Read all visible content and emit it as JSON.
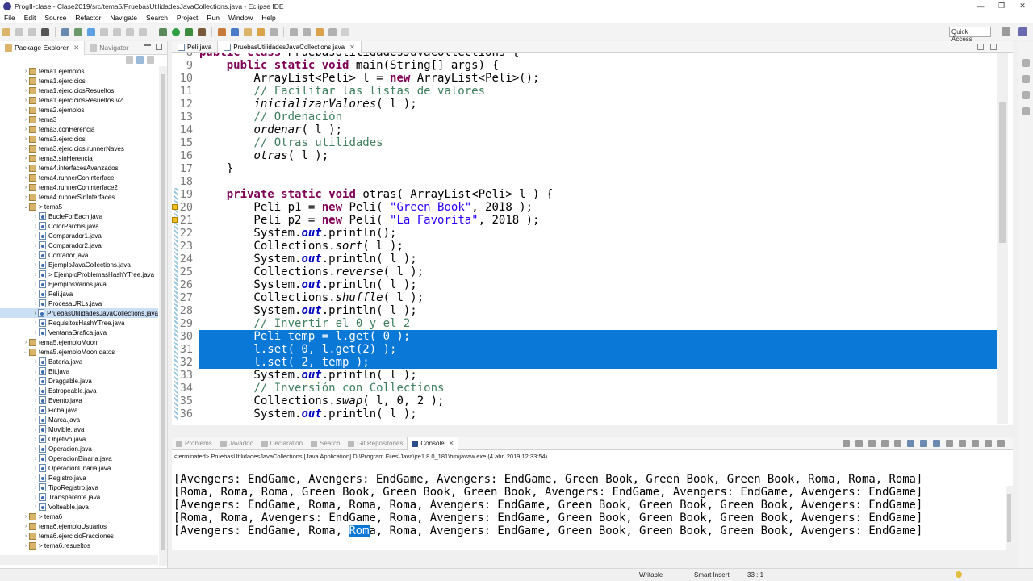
{
  "window": {
    "title": "ProgII-clase - Clase2019/src/tema5/PruebasUtilidadesJavaCollections.java - Eclipse IDE"
  },
  "menu": [
    "File",
    "Edit",
    "Source",
    "Refactor",
    "Navigate",
    "Search",
    "Project",
    "Run",
    "Window",
    "Help"
  ],
  "toolbar": {
    "quick_access": "Quick Access"
  },
  "explorer": {
    "tabs": [
      "Package Explorer",
      "Navigator"
    ],
    "items": [
      {
        "label": "tema1.ejemplos",
        "type": "pkg",
        "indent": 0,
        "arrow": "›"
      },
      {
        "label": "tema1.ejercicios",
        "type": "pkg",
        "indent": 0,
        "arrow": "›"
      },
      {
        "label": "tema1.ejerciciosResueltos",
        "type": "pkg",
        "indent": 0,
        "arrow": "›"
      },
      {
        "label": "tema1.ejerciciosResueltos.v2",
        "type": "pkg",
        "indent": 0,
        "arrow": "›"
      },
      {
        "label": "tema2.ejemplos",
        "type": "pkg",
        "indent": 0,
        "arrow": "›"
      },
      {
        "label": "tema3",
        "type": "pkg",
        "indent": 0,
        "arrow": "›"
      },
      {
        "label": "tema3.conHerencia",
        "type": "pkg",
        "indent": 0,
        "arrow": "›"
      },
      {
        "label": "tema3.ejercicios",
        "type": "pkg",
        "indent": 0,
        "arrow": "›"
      },
      {
        "label": "tema3.ejercicios.runnerNaves",
        "type": "pkg",
        "indent": 0,
        "arrow": "›"
      },
      {
        "label": "tema3.sinHerencia",
        "type": "pkg",
        "indent": 0,
        "arrow": "›"
      },
      {
        "label": "tema4.interfacesAvanzados",
        "type": "pkg",
        "indent": 0,
        "arrow": "›"
      },
      {
        "label": "tema4.runnerConInterface",
        "type": "pkg",
        "indent": 0,
        "arrow": "›"
      },
      {
        "label": "tema4.runnerConInterface2",
        "type": "pkg",
        "indent": 0,
        "arrow": "›"
      },
      {
        "label": "tema4.runnerSinInterfaces",
        "type": "pkg",
        "indent": 0,
        "arrow": "›"
      },
      {
        "label": "> tema5",
        "type": "pkg",
        "indent": 0,
        "arrow": "⌄"
      },
      {
        "label": "BucleForEach.java",
        "type": "java",
        "indent": 1,
        "arrow": "›"
      },
      {
        "label": "ColorParchis.java",
        "type": "java",
        "indent": 1,
        "arrow": "›"
      },
      {
        "label": "Comparador1.java",
        "type": "java",
        "indent": 1,
        "arrow": "›"
      },
      {
        "label": "Comparador2.java",
        "type": "java",
        "indent": 1,
        "arrow": "›"
      },
      {
        "label": "Contador.java",
        "type": "java",
        "indent": 1,
        "arrow": "›"
      },
      {
        "label": "EjemploJavaCollections.java",
        "type": "java",
        "indent": 1,
        "arrow": "›"
      },
      {
        "label": "> EjemploProblemasHashYTree.java",
        "type": "java",
        "indent": 1,
        "arrow": "›"
      },
      {
        "label": "EjemplosVarios.java",
        "type": "java",
        "indent": 1,
        "arrow": "›"
      },
      {
        "label": "Peli.java",
        "type": "java",
        "indent": 1,
        "arrow": "›"
      },
      {
        "label": "ProcesaURLs.java",
        "type": "java",
        "indent": 1,
        "arrow": "›"
      },
      {
        "label": "PruebasUtilidadesJavaCollections.java",
        "type": "java",
        "indent": 1,
        "arrow": "›",
        "selected": true
      },
      {
        "label": "RequisitosHashYTree.java",
        "type": "java",
        "indent": 1,
        "arrow": "›"
      },
      {
        "label": "VentanaGrafica.java",
        "type": "java",
        "indent": 1,
        "arrow": "›"
      },
      {
        "label": "tema5.ejemploMoon",
        "type": "pkg",
        "indent": 0,
        "arrow": "›"
      },
      {
        "label": "tema5.ejemploMoon.datos",
        "type": "pkg",
        "indent": 0,
        "arrow": "⌄"
      },
      {
        "label": "Bateria.java",
        "type": "java",
        "indent": 1,
        "arrow": "›"
      },
      {
        "label": "Bit.java",
        "type": "java",
        "indent": 1,
        "arrow": "›"
      },
      {
        "label": "Draggable.java",
        "type": "java",
        "indent": 1,
        "arrow": "›"
      },
      {
        "label": "Estropeable.java",
        "type": "java",
        "indent": 1,
        "arrow": "›"
      },
      {
        "label": "Evento.java",
        "type": "java",
        "indent": 1,
        "arrow": "›"
      },
      {
        "label": "Ficha.java",
        "type": "java",
        "indent": 1,
        "arrow": "›"
      },
      {
        "label": "Marca.java",
        "type": "java",
        "indent": 1,
        "arrow": "›"
      },
      {
        "label": "Movible.java",
        "type": "java",
        "indent": 1,
        "arrow": "›"
      },
      {
        "label": "Objetivo.java",
        "type": "java",
        "indent": 1,
        "arrow": "›"
      },
      {
        "label": "Operacion.java",
        "type": "java",
        "indent": 1,
        "arrow": "›"
      },
      {
        "label": "OperacionBinaria.java",
        "type": "java",
        "indent": 1,
        "arrow": "›"
      },
      {
        "label": "OperacionUnaria.java",
        "type": "java",
        "indent": 1,
        "arrow": "›"
      },
      {
        "label": "Registro.java",
        "type": "java",
        "indent": 1,
        "arrow": "›"
      },
      {
        "label": "TipoRegistro.java",
        "type": "java",
        "indent": 1,
        "arrow": "›"
      },
      {
        "label": "Transparente.java",
        "type": "java",
        "indent": 1,
        "arrow": "›"
      },
      {
        "label": "Volteable.java",
        "type": "java",
        "indent": 1,
        "arrow": "›"
      },
      {
        "label": "> tema6",
        "type": "pkg",
        "indent": 0,
        "arrow": "›"
      },
      {
        "label": "tema6.ejemploUsuarios",
        "type": "pkg",
        "indent": 0,
        "arrow": "›"
      },
      {
        "label": "tema6.ejercicioFracciones",
        "type": "pkg",
        "indent": 0,
        "arrow": "›"
      },
      {
        "label": "> tema6.resueltos",
        "type": "pkg",
        "indent": 0,
        "arrow": "›"
      }
    ]
  },
  "editor": {
    "tabs": [
      "Peli.java",
      "PruebasUtilidadesJavaCollections.java"
    ],
    "active_tab": 1,
    "lines": [
      {
        "n": "8",
        "html": "<span class=\"kw\">public</span> <span class=\"kw\">class</span> PruebasUtilidadesJavaCollections {"
      },
      {
        "n": "9",
        "html": "    <span class=\"kw\">public</span> <span class=\"kw\">static</span> <span class=\"kw\">void</span> main(String[] args) {"
      },
      {
        "n": "10",
        "html": "        ArrayList&lt;Peli&gt; l = <span class=\"kw\">new</span> ArrayList&lt;Peli&gt;();"
      },
      {
        "n": "11",
        "html": "        <span class=\"cm\">// Facilitar las listas de valores</span>"
      },
      {
        "n": "12",
        "html": "        <span class=\"it\">inicializarValores</span>( l );"
      },
      {
        "n": "13",
        "html": "        <span class=\"cm\">// Ordenación</span>"
      },
      {
        "n": "14",
        "html": "        <span class=\"it\">ordenar</span>( l );"
      },
      {
        "n": "15",
        "html": "        <span class=\"cm\">// Otras utilidades</span>"
      },
      {
        "n": "16",
        "html": "        <span class=\"it\">otras</span>( l );"
      },
      {
        "n": "17",
        "html": "    }"
      },
      {
        "n": "18",
        "html": ""
      },
      {
        "n": "19",
        "html": "    <span class=\"kw\">private</span> <span class=\"kw\">static</span> <span class=\"kw\">void</span> otras( ArrayList&lt;Peli&gt; l ) {"
      },
      {
        "n": "20",
        "html": "        Peli p1 = <span class=\"kw\">new</span> Peli( <span class=\"st\">\"Green Book\"</span>, 2018 );"
      },
      {
        "n": "21",
        "html": "        Peli p2 = <span class=\"kw\">new</span> Peli( <span class=\"st\">\"La Favorita\"</span>, 2018 );"
      },
      {
        "n": "22",
        "html": "        System.<span class=\"fld\">out</span>.println();"
      },
      {
        "n": "23",
        "html": "        Collections.<span class=\"it\">sort</span>( l );"
      },
      {
        "n": "24",
        "html": "        System.<span class=\"fld\">out</span>.println( l );"
      },
      {
        "n": "25",
        "html": "        Collections.<span class=\"it\">reverse</span>( l );"
      },
      {
        "n": "26",
        "html": "        System.<span class=\"fld\">out</span>.println( l );"
      },
      {
        "n": "27",
        "html": "        Collections.<span class=\"it\">shuffle</span>( l );"
      },
      {
        "n": "28",
        "html": "        System.<span class=\"fld\">out</span>.println( l );"
      },
      {
        "n": "29",
        "html": "        <span class=\"cm\">// Invertir el 0 y el 2</span>"
      },
      {
        "n": "30",
        "html": "        Peli temp = l.get( 0 );",
        "sel": true
      },
      {
        "n": "31",
        "html": "        l.set( 0, l.get(2) );",
        "sel": true
      },
      {
        "n": "32",
        "html": "        l.set( 2, temp );",
        "sel": true
      },
      {
        "n": "33",
        "html": "        System.<span class=\"fld\">out</span>.println( l );"
      },
      {
        "n": "34",
        "html": "        <span class=\"cm\">// Inversión con Collections</span>"
      },
      {
        "n": "35",
        "html": "        Collections.<span class=\"it\">swap</span>( l, 0, 2 );"
      },
      {
        "n": "36",
        "html": "        System.<span class=\"fld\">out</span>.println( l );"
      }
    ]
  },
  "console": {
    "tabs": [
      "Problems",
      "Javadoc",
      "Declaration",
      "Search",
      "Git Repositories",
      "Console"
    ],
    "active_tab": 5,
    "terminated": "<terminated> PruebasUtilidadesJavaCollections [Java Application] D:\\Program Files\\Java\\jre1.8.0_181\\bin\\javaw.exe (4 abr. 2019 12:33:54)",
    "lines": [
      "[Avengers: EndGame, Avengers: EndGame, Avengers: EndGame, Green Book, Green Book, Green Book, Roma, Roma, Roma]",
      "[Roma, Roma, Roma, Green Book, Green Book, Green Book, Avengers: EndGame, Avengers: EndGame, Avengers: EndGame]",
      "[Avengers: EndGame, Roma, Roma, Roma, Avengers: EndGame, Green Book, Green Book, Green Book, Avengers: EndGame]",
      "[Roma, Roma, Avengers: EndGame, Roma, Avengers: EndGame, Green Book, Green Book, Green Book, Avengers: EndGame]"
    ],
    "last_line": {
      "before": "[Avengers: EndGame, Roma, ",
      "selected": "Rom",
      "after": "a, Roma, Avengers: EndGame, Green Book, Green Book, Green Book, Avengers: EndGame]"
    }
  },
  "status": {
    "writable": "Writable",
    "insert_mode": "Smart Insert",
    "position": "33 : 1"
  }
}
